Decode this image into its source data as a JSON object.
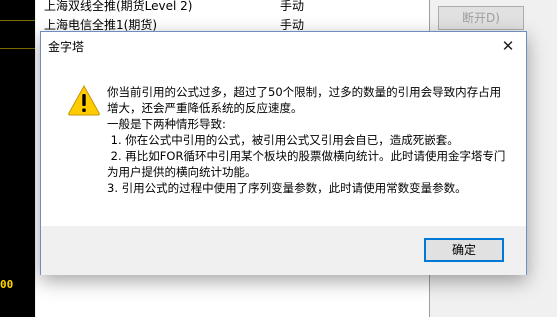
{
  "background": {
    "rows": [
      {
        "name": "上海双线全推(期货Level 2)",
        "type": "手动"
      },
      {
        "name": "上海电信全推1(期货)",
        "type": "手动"
      }
    ],
    "disconnect_label": "断开D)",
    "left_number": "00"
  },
  "dialog": {
    "title": "金字塔",
    "close_glyph": "✕",
    "icon": "warning-icon",
    "message_lines": [
      "你当前引用的公式过多，超过了50个限制，过多的数量的引用会导致内存占用",
      "增大，还会严重降低系统的反应速度。",
      "一般是下两种情形导致:",
      " 1. 你在公式中引用的公式，被引用公式又引用会自已，造成死嵌套。",
      " 2. 再比如FOR循环中引用某个板块的股票做横向统计。此时请使用金字塔专门",
      "为用户提供的横向统计功能。",
      "3. 引用公式的过程中使用了序列变量参数，此时请使用常数变量参数。"
    ],
    "ok_label": "确定"
  },
  "colors": {
    "accent": "#0078d7",
    "warning_yellow": "#ffcc00"
  }
}
